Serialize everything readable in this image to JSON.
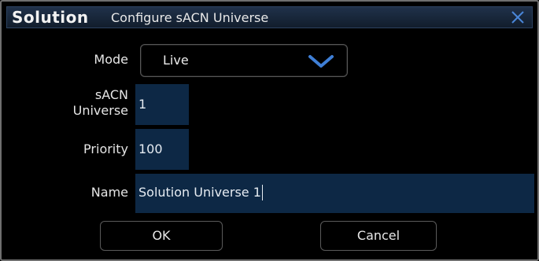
{
  "titlebar": {
    "brand": "Solution",
    "title": "Configure sACN Universe",
    "close_icon": "close-icon"
  },
  "form": {
    "mode": {
      "label": "Mode",
      "value": "Live",
      "icon": "chevron-down-icon"
    },
    "universe": {
      "label_line1": "sACN",
      "label_line2": "Universe",
      "value": "1"
    },
    "priority": {
      "label": "Priority",
      "value": "100"
    },
    "name": {
      "label": "Name",
      "value": "Solution Universe 1"
    }
  },
  "buttons": {
    "ok": "OK",
    "cancel": "Cancel"
  },
  "colors": {
    "titlebar": "#172538",
    "field_background": "#0d2845",
    "accent": "#3f7fd6"
  }
}
